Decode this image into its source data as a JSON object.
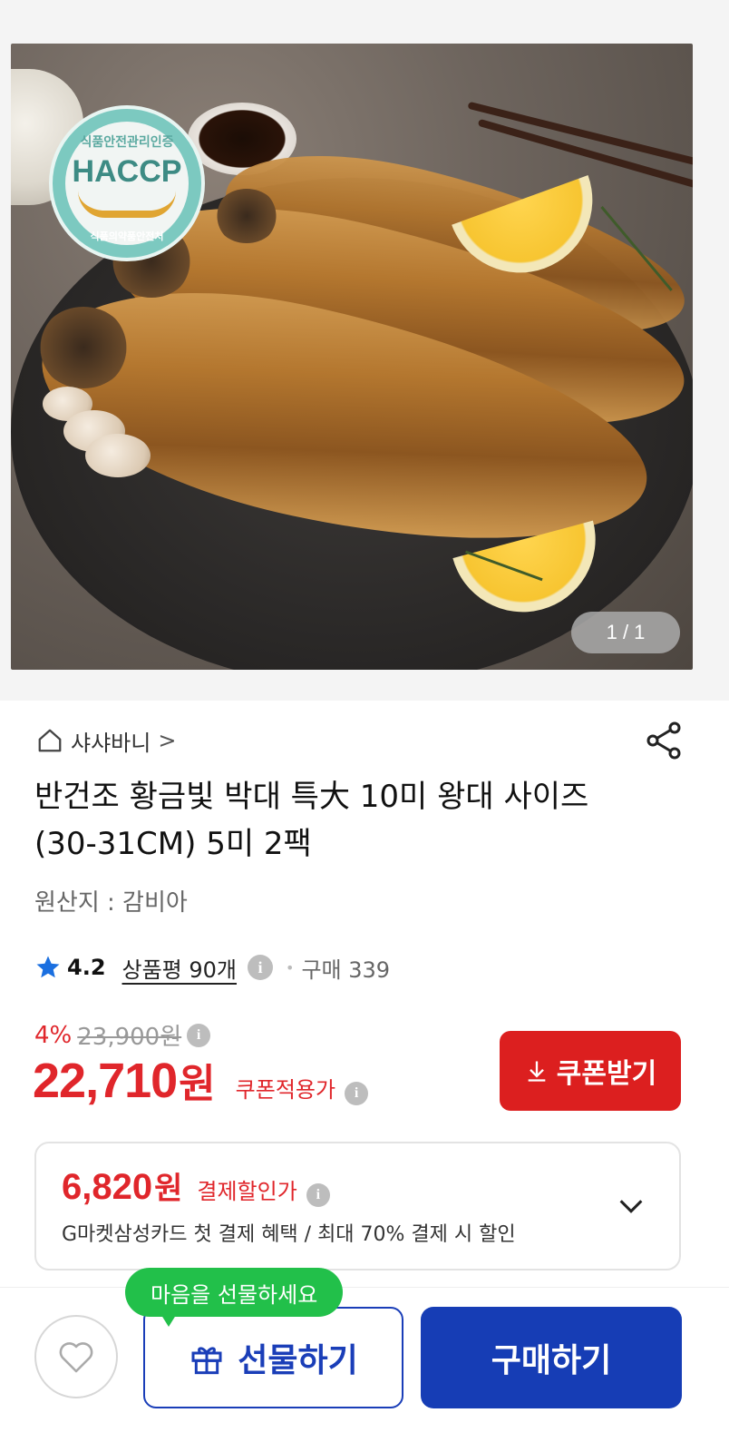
{
  "gallery": {
    "badge": {
      "top": "식품안전관리인증",
      "main": "HACCP",
      "bottom": "식품의약품안전처"
    },
    "counter": "1 / 1"
  },
  "product": {
    "seller": "샤샤바니",
    "seller_chevron": ">",
    "title": "반건조 황금빛 박대 특大 10미 왕대 사이즈 (30-31CM) 5미 2팩",
    "origin": "원산지 : 감비아"
  },
  "rating": {
    "score": "4.2",
    "reviews": "상품평 90개",
    "info": "i",
    "purchases": "구매 339"
  },
  "pricing": {
    "discount_percent": "4%",
    "original_price": "23,900원",
    "price": "22,710",
    "price_unit": "원",
    "price_label": "쿠폰적용가",
    "coupon_button": "쿠폰받기",
    "accent_color": "#e0262b"
  },
  "card_benefit": {
    "amount": "6,820",
    "unit": "원",
    "label": "결제할인가",
    "description": "G마켓삼성카드 첫 결제 혜택 / 최대 70% 결제 시 할인"
  },
  "actions": {
    "gift_bubble": "마음을 선물하세요",
    "gift_button": "선물하기",
    "buy_button": "구매하기",
    "primary_color": "#163db5"
  },
  "icons": [
    "home-icon",
    "chevron-right-icon",
    "share-icon",
    "star-icon",
    "info-icon",
    "download-icon",
    "chevron-down-icon",
    "heart-icon",
    "gift-icon"
  ]
}
